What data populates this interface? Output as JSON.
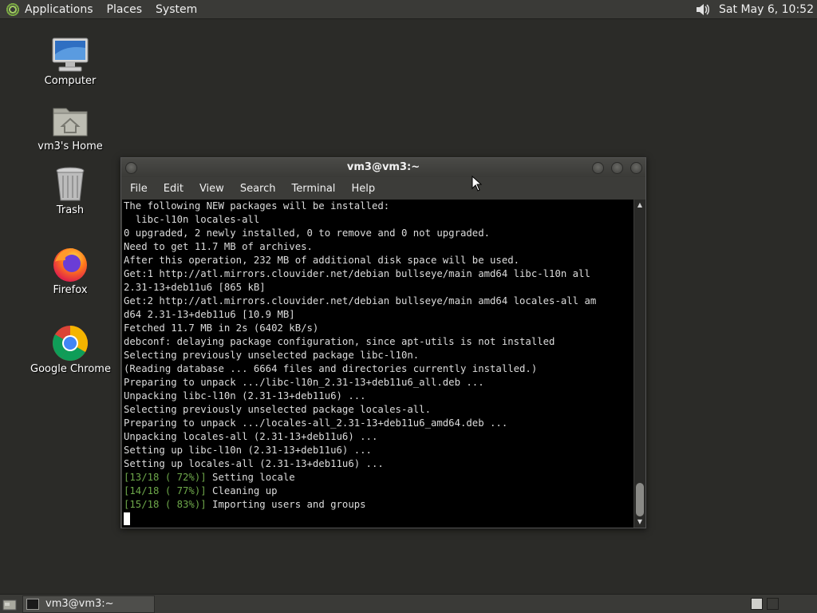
{
  "top_panel": {
    "menus": [
      "Applications",
      "Places",
      "System"
    ],
    "clock": "Sat May  6, 10:52"
  },
  "desktop_icons": [
    {
      "label": "Computer",
      "icon": "computer-icon"
    },
    {
      "label": "vm3's Home",
      "icon": "home-folder-icon"
    },
    {
      "label": "Trash",
      "icon": "trash-icon"
    },
    {
      "label": "Firefox",
      "icon": "firefox-icon"
    },
    {
      "label": "Google Chrome",
      "icon": "chrome-icon"
    }
  ],
  "window": {
    "title": "vm3@vm3:~",
    "menu": [
      "File",
      "Edit",
      "View",
      "Search",
      "Terminal",
      "Help"
    ]
  },
  "terminal": {
    "lines": [
      "The following NEW packages will be installed:",
      "  libc-l10n locales-all",
      "0 upgraded, 2 newly installed, 0 to remove and 0 not upgraded.",
      "Need to get 11.7 MB of archives.",
      "After this operation, 232 MB of additional disk space will be used.",
      "Get:1 http://atl.mirrors.clouvider.net/debian bullseye/main amd64 libc-l10n all",
      "2.31-13+deb11u6 [865 kB]",
      "Get:2 http://atl.mirrors.clouvider.net/debian bullseye/main amd64 locales-all am",
      "d64 2.31-13+deb11u6 [10.9 MB]",
      "Fetched 11.7 MB in 2s (6402 kB/s)",
      "debconf: delaying package configuration, since apt-utils is not installed",
      "Selecting previously unselected package libc-l10n.",
      "(Reading database ... 6664 files and directories currently installed.)",
      "Preparing to unpack .../libc-l10n_2.31-13+deb11u6_all.deb ...",
      "Unpacking libc-l10n (2.31-13+deb11u6) ...",
      "Selecting previously unselected package locales-all.",
      "Preparing to unpack .../locales-all_2.31-13+deb11u6_amd64.deb ...",
      "Unpacking locales-all (2.31-13+deb11u6) ...",
      "Setting up libc-l10n (2.31-13+deb11u6) ...",
      "Setting up locales-all (2.31-13+deb11u6) ..."
    ],
    "progress": [
      {
        "tag": "[13/18 ( 72%)]",
        "text": " Setting locale"
      },
      {
        "tag": "[14/18 ( 77%)]",
        "text": " Cleaning up"
      },
      {
        "tag": "[15/18 ( 83%)]",
        "text": " Importing users and groups"
      }
    ]
  },
  "taskbar": {
    "task_label": "vm3@vm3:~"
  },
  "colors": {
    "desktop": "#2b2b28",
    "panel": "#3a3a37",
    "progress_text": "#6ea84a"
  }
}
